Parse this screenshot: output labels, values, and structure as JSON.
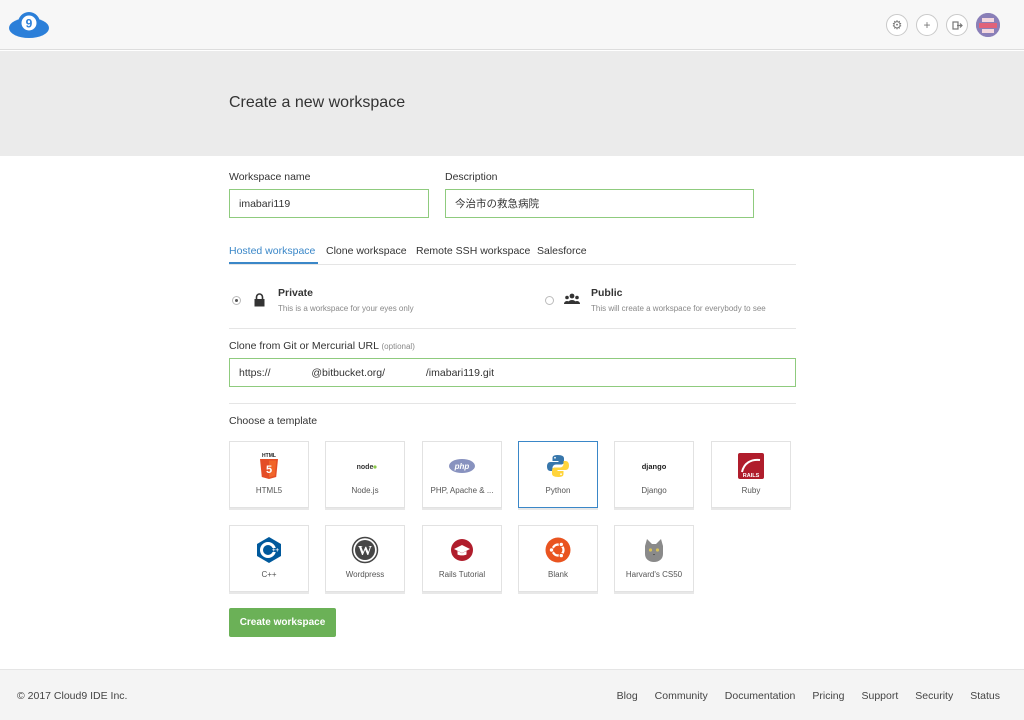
{
  "topbar": {
    "logo_text": "9",
    "logo_color": "#2b7fd9",
    "icons": [
      "gear-icon",
      "plus-icon",
      "logout-icon",
      "avatar"
    ]
  },
  "hero": {
    "title": "Create a new workspace"
  },
  "form": {
    "workspace_name_label": "Workspace name",
    "workspace_name_value": "imabari119",
    "description_label": "Description",
    "description_value": "今治市の救急病院",
    "tabs": [
      "Hosted workspace",
      "Clone workspace",
      "Remote SSH workspace",
      "Salesforce"
    ],
    "active_tab": "Hosted workspace",
    "visibility": {
      "private_title": "Private",
      "private_sub": "This is a workspace for your eyes only",
      "public_title": "Public",
      "public_sub": "This will create a workspace for everybody to see",
      "selected": "Private"
    },
    "clone_label": "Clone from Git or Mercurial URL",
    "clone_optional": "(optional)",
    "clone_value": "https://              @bitbucket.org/              /imabari119.git",
    "template_label": "Choose a template",
    "templates": [
      {
        "name": "HTML5",
        "icon": "html5-icon"
      },
      {
        "name": "Node.js",
        "icon": "nodejs-icon"
      },
      {
        "name": "PHP, Apache & ...",
        "icon": "php-icon"
      },
      {
        "name": "Python",
        "icon": "python-icon",
        "selected": true
      },
      {
        "name": "Django",
        "icon": "django-icon"
      },
      {
        "name": "Ruby",
        "icon": "rails-icon"
      },
      {
        "name": "C++",
        "icon": "cpp-icon"
      },
      {
        "name": "Wordpress",
        "icon": "wordpress-icon"
      },
      {
        "name": "Rails Tutorial",
        "icon": "rails-tutorial-icon"
      },
      {
        "name": "Blank",
        "icon": "ubuntu-icon"
      },
      {
        "name": "Harvard's CS50",
        "icon": "cat-icon"
      }
    ],
    "create_button": "Create workspace"
  },
  "footer": {
    "copyright": "© 2017 Cloud9 IDE Inc.",
    "links": [
      "Blog",
      "Community",
      "Documentation",
      "Pricing",
      "Support",
      "Security",
      "Status"
    ]
  },
  "colors": {
    "accent": "#3a87c8",
    "valid_border": "#8fcb7e",
    "primary_button": "#6bb157"
  }
}
